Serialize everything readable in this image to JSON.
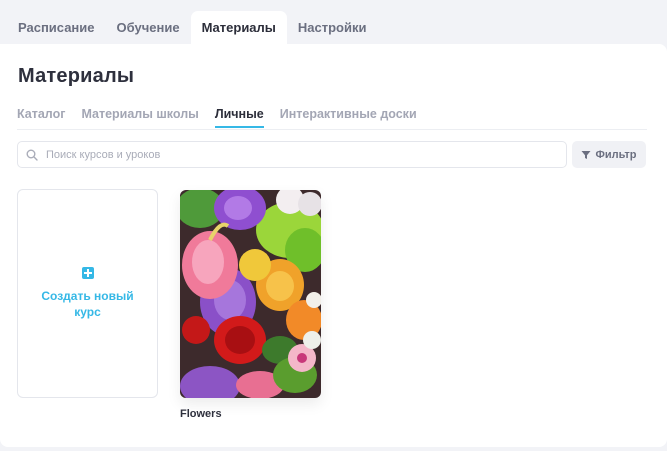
{
  "top_tabs": [
    {
      "label": "Расписание",
      "active": false
    },
    {
      "label": "Обучение",
      "active": false
    },
    {
      "label": "Материалы",
      "active": true
    },
    {
      "label": "Настройки",
      "active": false
    }
  ],
  "page": {
    "title": "Материалы"
  },
  "sub_tabs": [
    {
      "label": "Каталог",
      "active": false
    },
    {
      "label": "Материалы школы",
      "active": false
    },
    {
      "label": "Личные",
      "active": true
    },
    {
      "label": "Интерактивные доски",
      "active": false
    }
  ],
  "search": {
    "placeholder": "Поиск курсов и уроков",
    "value": ""
  },
  "filter": {
    "label": "Фильтр"
  },
  "create_card": {
    "label": "Создать новый курс"
  },
  "courses": [
    {
      "title": "Flowers",
      "cover": "flowers-bouquet-photo"
    }
  ],
  "colors": {
    "accent": "#35b8e6",
    "text": "#2e303d",
    "muted": "#a3a6b4"
  }
}
